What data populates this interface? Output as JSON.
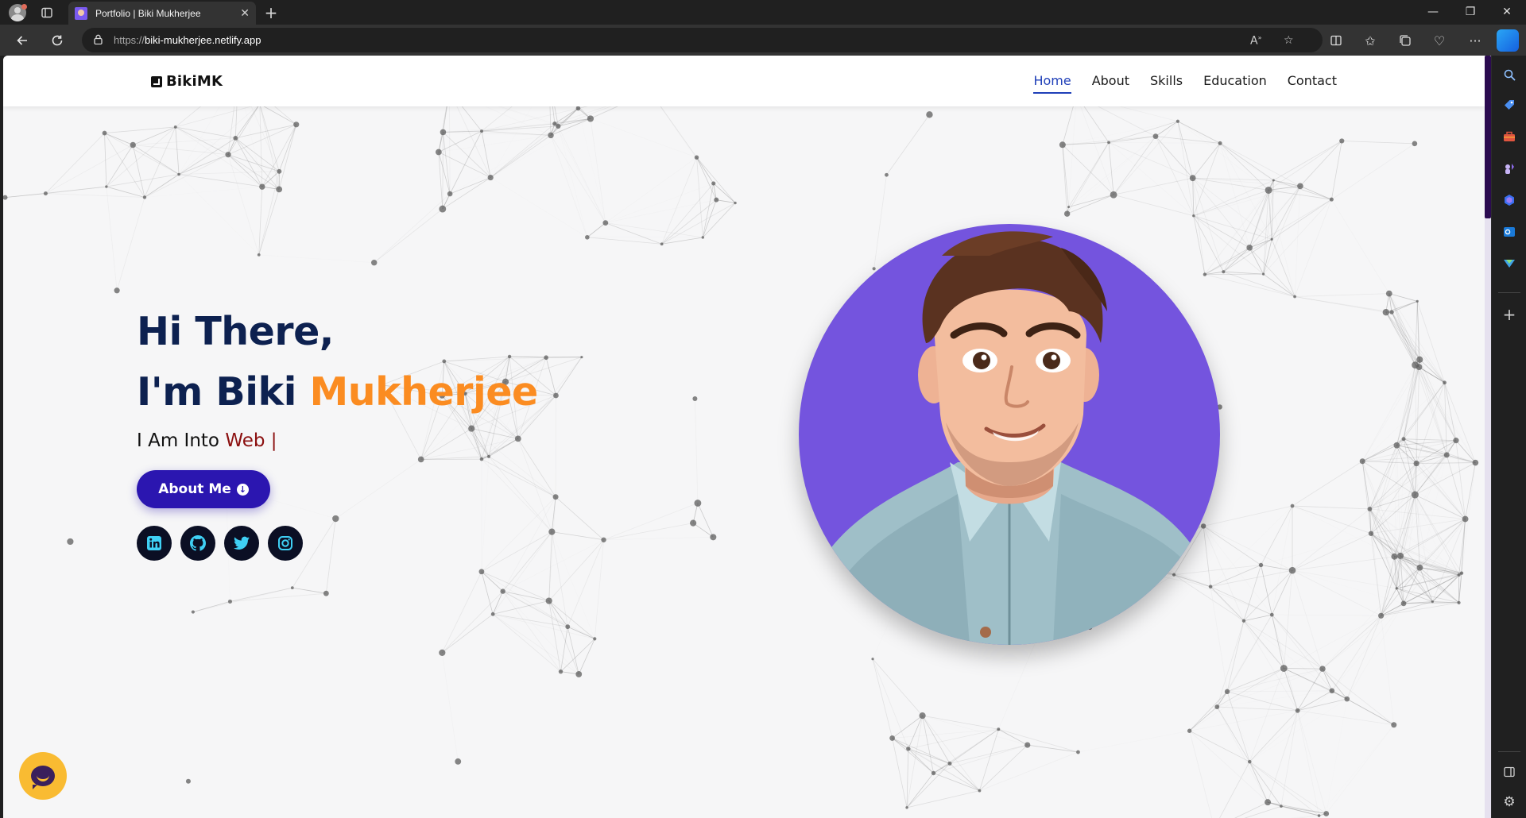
{
  "browser": {
    "tab": {
      "title": "Portfolio | Biki Mukherjee"
    },
    "address": {
      "scheme": "https://",
      "host": "biki-mukherjee.netlify.app"
    },
    "icons": {
      "profile": "profile-avatar-icon",
      "workspaces": "workspaces-icon",
      "new_tab": "plus-icon",
      "back": "back-arrow-icon",
      "refresh": "refresh-icon",
      "read_aloud": "read-aloud-icon",
      "favorite": "star-icon",
      "split_screen": "split-screen-icon",
      "favorites": "favorites-icon",
      "collections": "collections-icon",
      "browser_essentials": "heart-pulse-icon",
      "more": "ellipsis-icon",
      "copilot": "copilot-icon"
    },
    "sidebar_icons": [
      "search-icon",
      "shopping-tag-icon",
      "toolbox-icon",
      "games-icon",
      "copilot-app-icon",
      "outlook-icon",
      "drop-icon",
      "add-icon",
      "sidebar-toggle-icon",
      "settings-icon"
    ]
  },
  "site": {
    "brand": "BikiMK",
    "nav": [
      {
        "label": "Home",
        "active": true
      },
      {
        "label": "About",
        "active": false
      },
      {
        "label": "Skills",
        "active": false
      },
      {
        "label": "Education",
        "active": false
      },
      {
        "label": "Contact",
        "active": false
      }
    ],
    "hero": {
      "greeting": "Hi There,",
      "intro": "I'm Biki ",
      "highlight": "Mukherjee",
      "typing_prefix": "I Am Into ",
      "typing_word": "Web |",
      "cta_label": "About Me",
      "socials": [
        "linkedin-icon",
        "github-icon",
        "twitter-icon",
        "instagram-icon"
      ]
    },
    "colors": {
      "navy": "#0d2150",
      "orange": "#fb8c21",
      "cta": "#2b16b0",
      "nav_active": "#1f3fb8",
      "photo_bg": "#7454de",
      "chat": "#f9bb32"
    }
  }
}
